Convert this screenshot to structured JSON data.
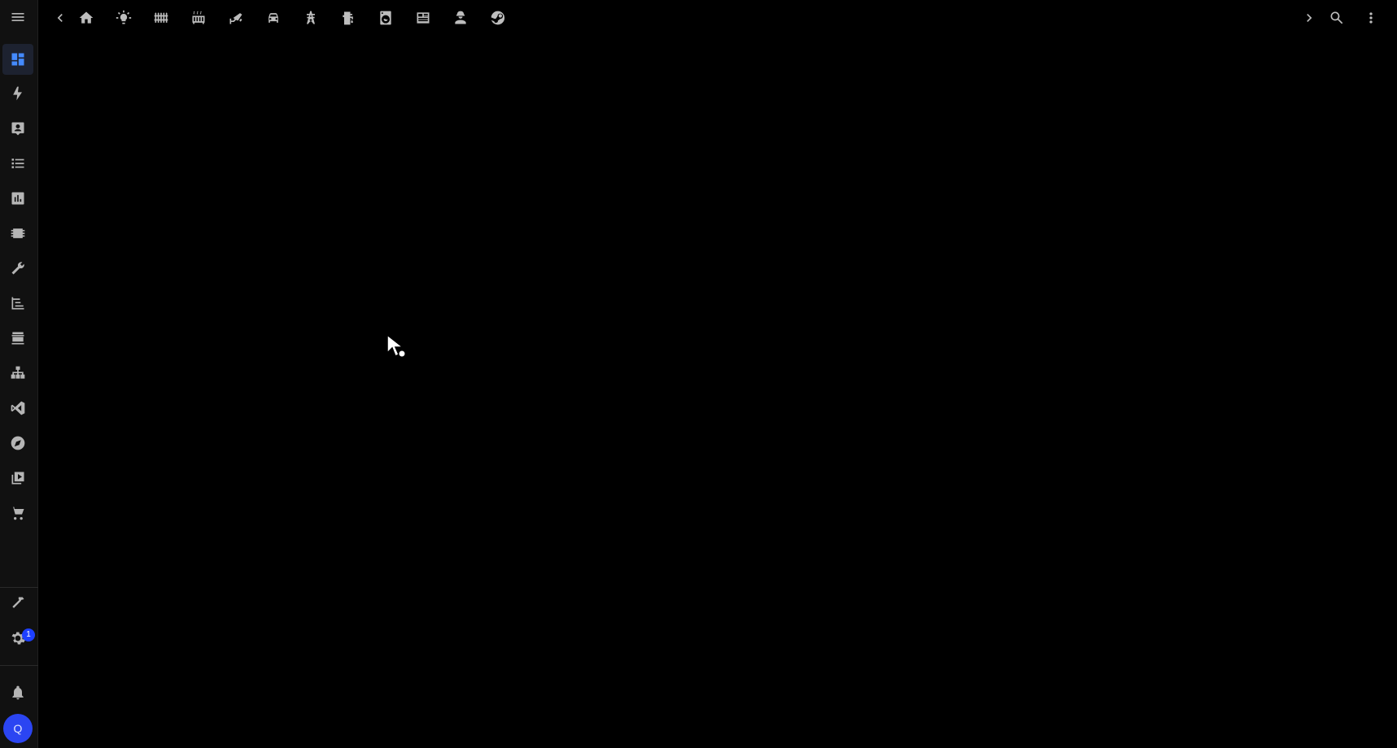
{
  "app": {
    "accent": "#448aff",
    "sidebar_bg": "#111111",
    "background": "#000000"
  },
  "sidebar": {
    "items": [
      {
        "name": "dashboard",
        "icon": "view-dashboard-icon",
        "active": true
      },
      {
        "name": "energy",
        "icon": "lightning-bolt-icon"
      },
      {
        "name": "map",
        "icon": "account-box-icon"
      },
      {
        "name": "logbook",
        "icon": "format-list-bulleted-icon"
      },
      {
        "name": "history",
        "icon": "chart-box-icon"
      },
      {
        "name": "esphome",
        "icon": "chip-icon"
      },
      {
        "name": "tools",
        "icon": "wrench-icon"
      },
      {
        "name": "node-red",
        "icon": "sitemap-outline-icon"
      },
      {
        "name": "hacs",
        "icon": "hacs-store-icon"
      },
      {
        "name": "zigbee",
        "icon": "hierarchy-icon"
      },
      {
        "name": "vscode",
        "icon": "code-editor-icon"
      },
      {
        "name": "explore",
        "icon": "compass-icon"
      },
      {
        "name": "media",
        "icon": "play-box-multiple-icon"
      },
      {
        "name": "shopping-list",
        "icon": "cart-icon"
      }
    ],
    "developer_tools_icon": "hammer-icon",
    "settings_icon": "cog-icon",
    "settings_badge": "1",
    "notifications_icon": "bell-icon",
    "user_initial": "Q"
  },
  "topbar": {
    "menu_icon": "menu-icon",
    "scroll_left_icon": "chevron-left-icon",
    "scroll_right_icon": "chevron-right-icon",
    "search_icon": "magnify-icon",
    "more_icon": "dots-vertical-icon",
    "views": [
      "home-icon",
      "lightbulb-icon",
      "fence-icon",
      "radiator-icon",
      "cctv-icon",
      "car-icon",
      "transmission-tower-icon",
      "water-pump-icon",
      "washing-machine-icon",
      "newspaper-icon",
      "account-hard-hat-icon",
      "steam-icon"
    ]
  }
}
